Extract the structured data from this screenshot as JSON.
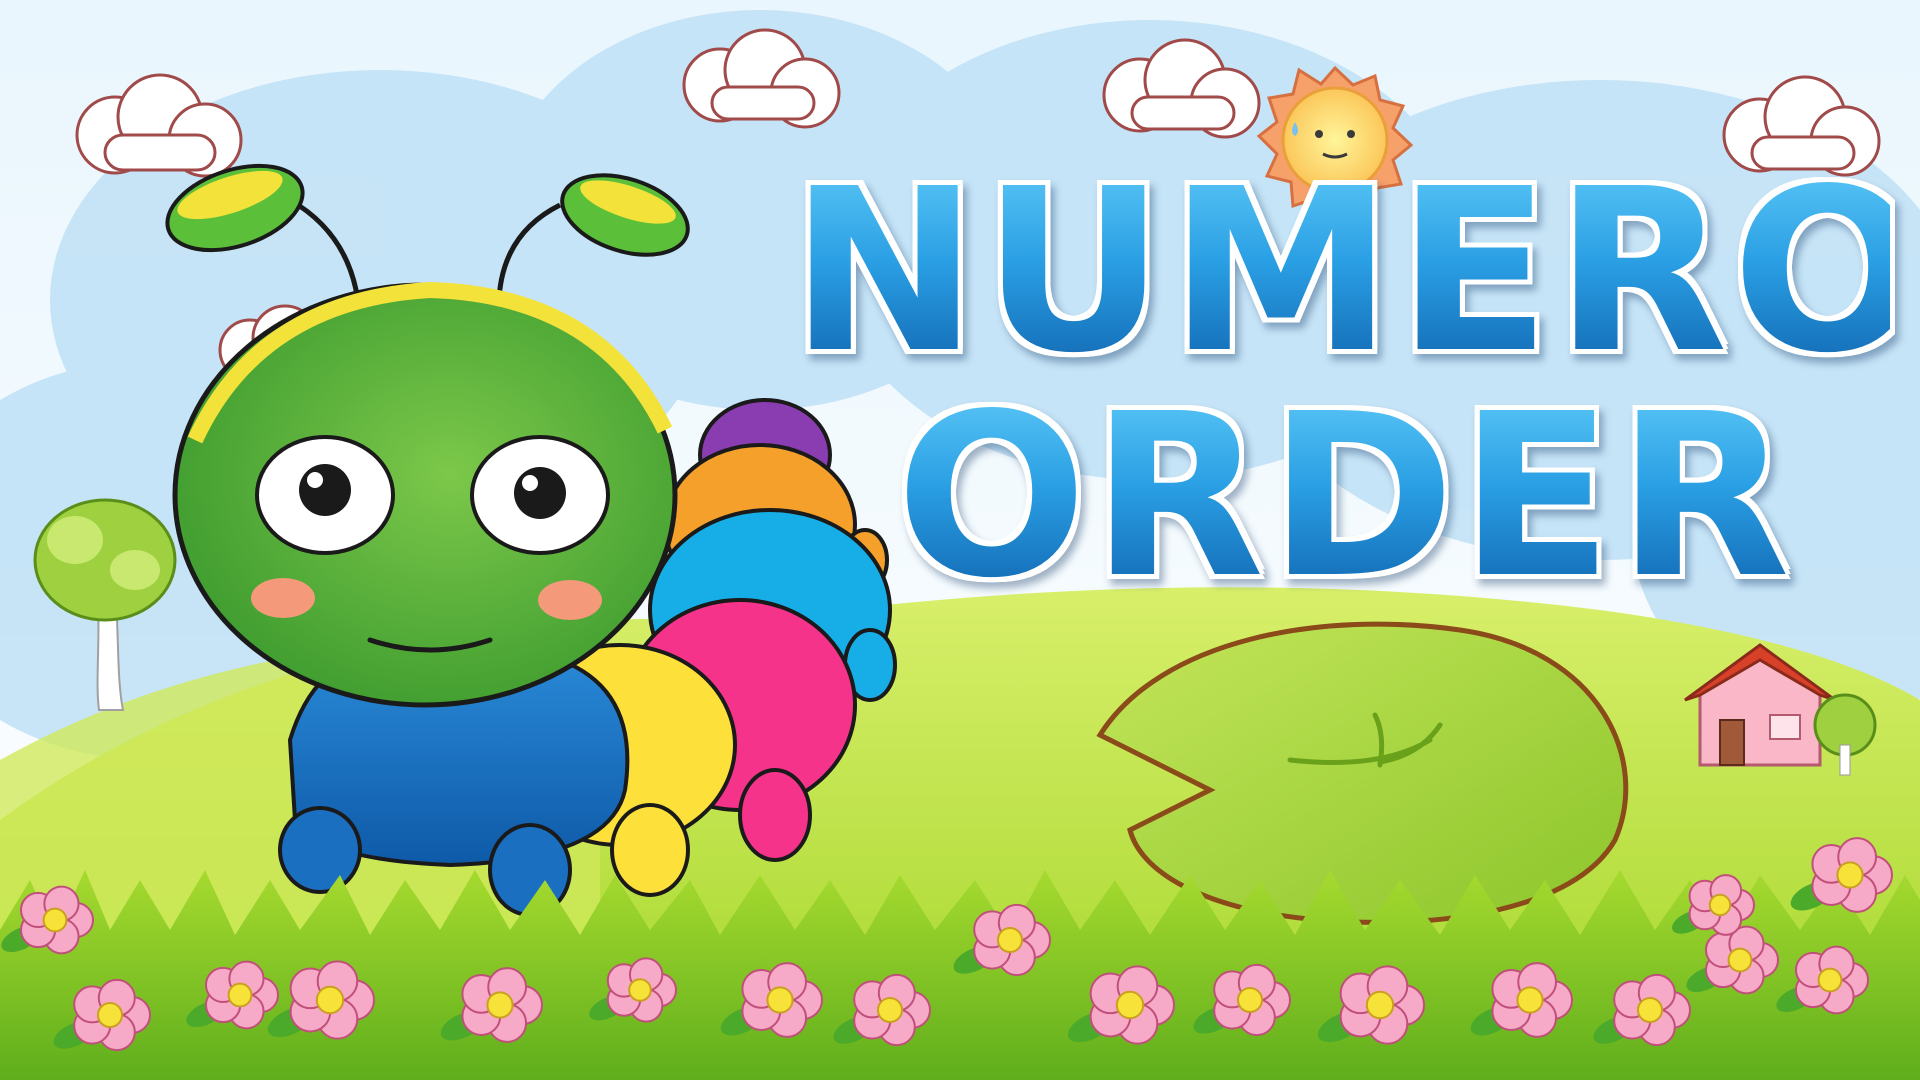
{
  "title": {
    "line1": "NUMERO",
    "line2": "ORDER"
  },
  "scene": {
    "character": "caterpillar-mascot",
    "props": [
      "lily-pad",
      "sun-face",
      "house",
      "trees",
      "clouds",
      "pink-flowers",
      "grass"
    ]
  },
  "colors": {
    "sky": "#cde9fa",
    "hill": "#b6e03a",
    "title_blue": "#1f86d0",
    "caterpillar_head": "#5cbf3a",
    "body_blue": "#1a6fc0",
    "segment_yellow": "#fde03a",
    "segment_pink": "#f5338a",
    "segment_cyan": "#17aee8",
    "segment_orange": "#f5a02a",
    "segment_purple": "#8a3db0",
    "flower_pink": "#f7a9c8",
    "flower_center": "#f7e23a"
  }
}
